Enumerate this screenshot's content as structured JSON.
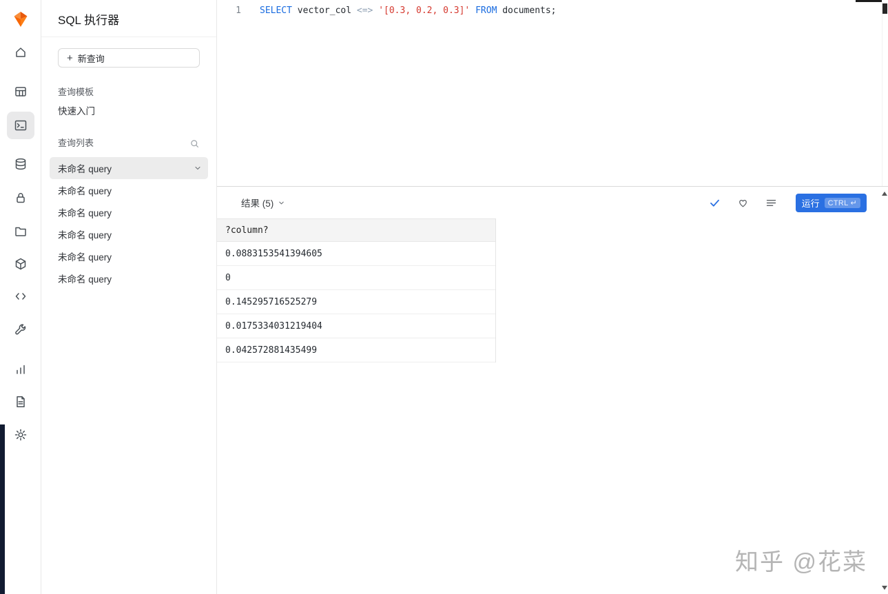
{
  "sidebar": {
    "title": "SQL 执行器",
    "new_query_plus": "+",
    "new_query": "新查询",
    "section_templates": "查询模板",
    "quick_start": "快速入门",
    "section_query_list": "查询列表",
    "queries": [
      {
        "label": "未命名 query",
        "selected": true
      },
      {
        "label": "未命名 query",
        "selected": false
      },
      {
        "label": "未命名 query",
        "selected": false
      },
      {
        "label": "未命名 query",
        "selected": false
      },
      {
        "label": "未命名 query",
        "selected": false
      },
      {
        "label": "未命名 query",
        "selected": false
      }
    ]
  },
  "rail": {
    "items": [
      "logo",
      "home",
      "table",
      "sql-terminal",
      "database",
      "lock",
      "folder",
      "package",
      "code",
      "tools",
      "chart",
      "document",
      "settings"
    ],
    "active": "sql-terminal"
  },
  "editor": {
    "line_number": "1",
    "code_plain": "SELECT vector_col <=> '[0.3, 0.2, 0.3]' FROM documents;",
    "tokens": [
      {
        "text": "SELECT ",
        "type": "keyword"
      },
      {
        "text": "vector_col ",
        "type": "identifier"
      },
      {
        "text": "<=> ",
        "type": "operator"
      },
      {
        "text": "'[0.3, 0.2, 0.3]' ",
        "type": "string"
      },
      {
        "text": "FROM ",
        "type": "keyword"
      },
      {
        "text": "documents;",
        "type": "identifier"
      }
    ]
  },
  "results": {
    "tab_label": "结果 (5)",
    "run_button": {
      "label": "运行",
      "shortcut": "CTRL ↵"
    },
    "table": {
      "columns": [
        "?column?"
      ],
      "rows": [
        "0.0883153541394605",
        "0",
        "0.145295716525279",
        "0.0175334031219404",
        "0.042572881435499"
      ]
    }
  },
  "colors": {
    "accent_blue": "#2a70e2",
    "logo_orange": "#f76707",
    "keyword_blue": "#1a6ce0",
    "string_red": "#d5392f",
    "operator_gray": "#8fa0b3"
  },
  "watermark": "知乎 @花菜"
}
